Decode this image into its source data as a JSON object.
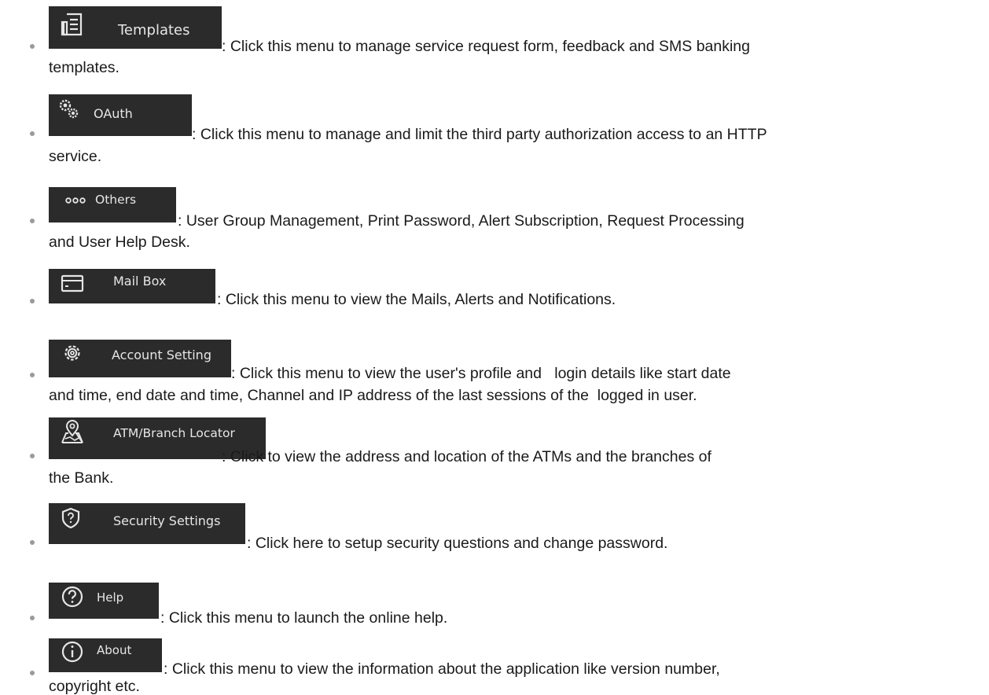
{
  "items": [
    {
      "menu_label": "Templates",
      "icon": "document-icon",
      "line1": ": Click this menu to manage service request form, feedback and SMS banking",
      "line2": "templates."
    },
    {
      "menu_label": "OAuth",
      "icon": "gears-icon",
      "line1": ": Click this menu to manage and limit the third party authorization access to an HTTP",
      "line2": "service."
    },
    {
      "menu_label": "Others",
      "icon": "ellipsis-icon",
      "line1": ": User Group Management, Print Password, Alert Subscription, Request Processing",
      "line2": "and User Help Desk."
    },
    {
      "menu_label": "Mail Box",
      "icon": "mailbox-icon",
      "line1": ": Click this menu to view the Mails, Alerts and Notifications."
    },
    {
      "menu_label": "Account Setting",
      "icon": "gear-icon",
      "line1": ": Click this menu to view the user's profile and   login details like start date",
      "line2": "and time, end date and time, Channel and IP address of the last sessions of the  logged in user."
    },
    {
      "menu_label": "ATM/Branch Locator",
      "icon": "map-pin-icon",
      "line1": ": Click to view the address and location of the ATMs and the branches of",
      "line2": "the Bank."
    },
    {
      "menu_label": "Security Settings",
      "icon": "shield-question-icon",
      "line1": ": Click here to setup security questions and change password."
    },
    {
      "menu_label": "Help",
      "icon": "help-circle-icon",
      "line1": ": Click this menu to launch the online help."
    },
    {
      "menu_label": "About",
      "icon": "info-circle-icon",
      "line1": ": Click this menu to view the information about the application like version number,",
      "line2": "copyright etc."
    }
  ],
  "colors": {
    "menu_bg": "#2b2b2b",
    "menu_text": "#e6e6e6",
    "bullet": "#9a9a9a",
    "body_text": "#1a1a1a"
  }
}
